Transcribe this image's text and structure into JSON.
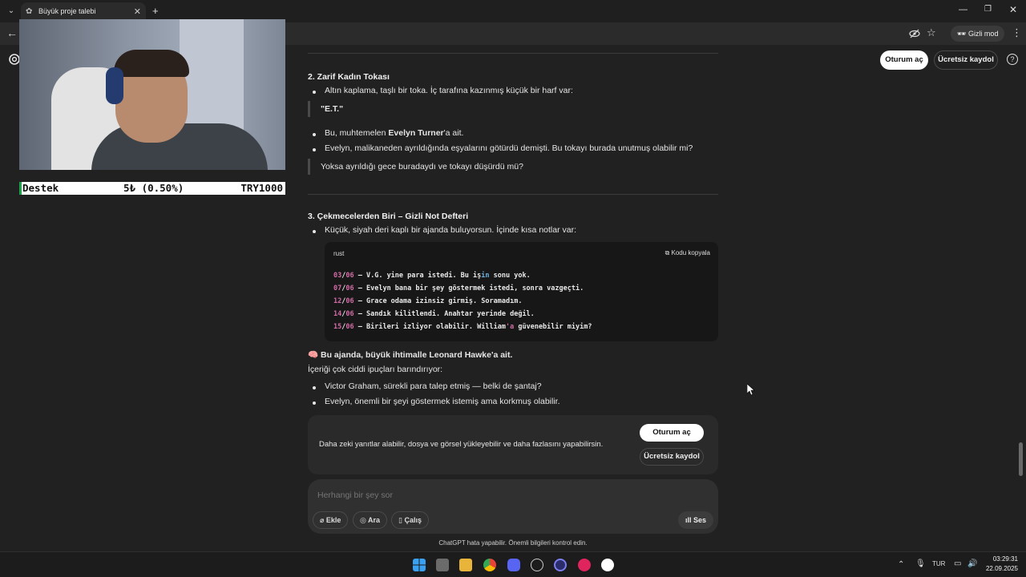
{
  "browser": {
    "tab_title": "Büyük proje talebi",
    "incognito_label": "Gizli mod"
  },
  "header": {
    "login": "Oturum aç",
    "signup": "Ücretsiz kaydol"
  },
  "overlay": {
    "donation_label": "Destek",
    "donation_amount": "5₺ (0.50%)",
    "donation_goal": "TRY1000"
  },
  "content": {
    "section2_title": "2. Zarif Kadın Tokası",
    "s2_bullet1": "Altın kaplama, taşlı bir toka. İç tarafına kazınmış küçük bir harf var:",
    "s2_quote1": "\"E.T.\"",
    "s2_bullet2_pre": "Bu, muhtemelen ",
    "s2_bullet2_bold": "Evelyn Turner",
    "s2_bullet2_post": "'a ait.",
    "s2_bullet3": "Evelyn, malikaneden ayrıldığında eşyalarını götürdü demişti. Bu tokayı burada unutmuş olabilir mi?",
    "s2_quote2": "Yoksa ayrıldığı gece buradaydı ve tokayı düşürdü mü?",
    "section3_title": "3. Çekmecelerden Biri – Gizli Not Defteri",
    "s3_bullet1": "Küçük, siyah deri kaplı bir ajanda buluyorsun. İçinde kısa notlar var:",
    "code": {
      "lang": "rust",
      "copy_label": "Kodu kopyala",
      "lines": [
        {
          "date_a": "03",
          "date_b": "06",
          "text": " – V.G. yine para istedi. Bu iş",
          "kw": "in",
          "rest": " sonu yok."
        },
        {
          "date_a": "07",
          "date_b": "06",
          "text": " – Evelyn bana bir şey göstermek istedi, sonra vazgeçti.",
          "kw": "",
          "rest": ""
        },
        {
          "date_a": "12",
          "date_b": "06",
          "text": " – Grace odama izinsiz girmiş. Soramadım.",
          "kw": "",
          "rest": ""
        },
        {
          "date_a": "14",
          "date_b": "06",
          "text": " – Sandık kilitlendi. Anahtar yerinde değil.",
          "kw": "",
          "rest": ""
        },
        {
          "date_a": "15",
          "date_b": "06",
          "text": " – Birileri izliyor olabilir. William",
          "kw": "'a",
          "rest": " güvenebilir miyim?"
        }
      ]
    },
    "brain_line": "🧠 Bu ajanda, büyük ihtimalle Leonard Hawke'a ait.",
    "intro": "İçeriği çok ciddi ipuçları barındırıyor:",
    "clue1": "Victor Graham, sürekli para talep etmiş — belki de şantaj?",
    "clue2": "Evelyn, önemli bir şeyi göstermek istemiş ama korkmuş olabilir."
  },
  "signup_card": {
    "text": "Daha zeki yanıtlar alabilir, dosya ve görsel yükleyebilir ve daha fazlasını yapabilirsin.",
    "login": "Oturum aç",
    "signup": "Ücretsiz kaydol"
  },
  "composer": {
    "placeholder": "Herhangi bir şey sor",
    "attach": "Ekle",
    "search": "Ara",
    "study": "Çalış",
    "voice": "Ses"
  },
  "disclaimer": "ChatGPT hata yapabilir. Önemli bilgileri kontrol edin.",
  "taskbar": {
    "lang": "TUR",
    "time": "03:29:31",
    "date": "22.09.2025"
  }
}
